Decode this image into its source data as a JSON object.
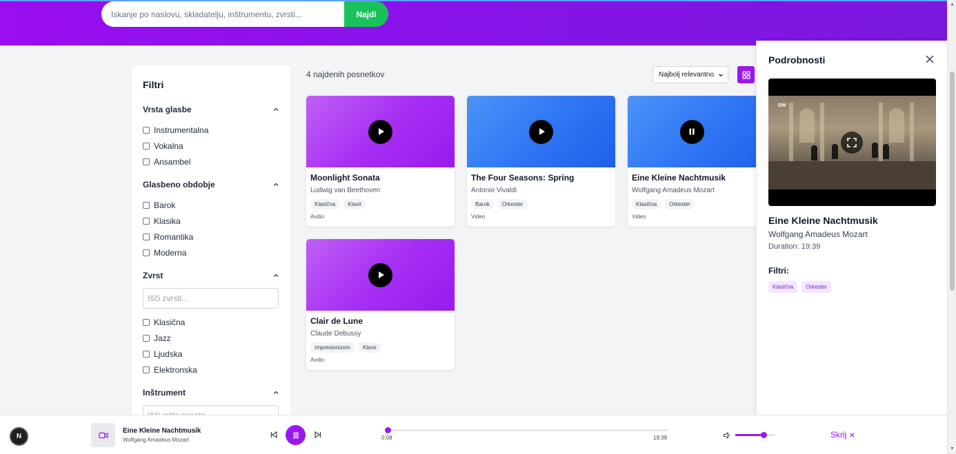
{
  "header": {
    "search_placeholder": "Iskanje po naslovu, skladatelju, inštrumentu, zvrsti...",
    "search_button": "Najdi"
  },
  "filters": {
    "title": "Filtri",
    "sections": [
      {
        "title": "Vrsta glasbe",
        "options": [
          "Instrumentalna",
          "Vokalna",
          "Ansambel"
        ]
      },
      {
        "title": "Glasbeno obdobje",
        "options": [
          "Barok",
          "Klasika",
          "Romantika",
          "Moderna"
        ]
      },
      {
        "title": "Zvrst",
        "search_placeholder": "Išči zvrsti...",
        "options": [
          "Klasična",
          "Jazz",
          "Ljudska",
          "Elektronska"
        ]
      },
      {
        "title": "Inštrument",
        "search_placeholder": "Išči inštrumente..."
      }
    ]
  },
  "results": {
    "count_label": "4 najdenih posnetkov",
    "sort_value": "Najbolj relevantno"
  },
  "cards": [
    {
      "title": "Moonlight Sonata",
      "artist": "Ludwig van Beethoven",
      "tags": [
        "Klasična",
        "Klavir"
      ],
      "type": "Avdio",
      "state": "play",
      "color": "purple"
    },
    {
      "title": "The Four Seasons: Spring",
      "artist": "Antonio Vivaldi",
      "tags": [
        "Barok",
        "Orkester"
      ],
      "type": "Video",
      "state": "play",
      "color": "blue"
    },
    {
      "title": "Eine Kleine Nachtmusik",
      "artist": "Wolfgang Amadeus Mozart",
      "tags": [
        "Klasična",
        "Orkester"
      ],
      "type": "Video",
      "state": "pause",
      "color": "blue"
    },
    {
      "title": "Clair de Lune",
      "artist": "Claude Debussy",
      "tags": [
        "Impresionizem",
        "Klavir"
      ],
      "type": "Avdio",
      "state": "play",
      "color": "purple"
    }
  ],
  "details": {
    "title": "Podrobnosti",
    "track": "Eine Kleine Nachtmusik",
    "artist": "Wolfgang Amadeus Mozart",
    "duration": "Duration: 19:39",
    "filters_label": "Filtri:",
    "tags": [
      "Klasična",
      "Orkester"
    ],
    "video_logo": "DW"
  },
  "player": {
    "badge": "N",
    "title": "Eine Kleine Nachtmusik",
    "artist": "Wolfgang Amadeus Mozart",
    "current_time": "0:08",
    "total_time": "19:39",
    "progress": 0.007,
    "volume": 0.7,
    "hide_label": "Skrij"
  },
  "colors": {
    "accent": "#9a17ee",
    "search_button": "#19c15a"
  }
}
